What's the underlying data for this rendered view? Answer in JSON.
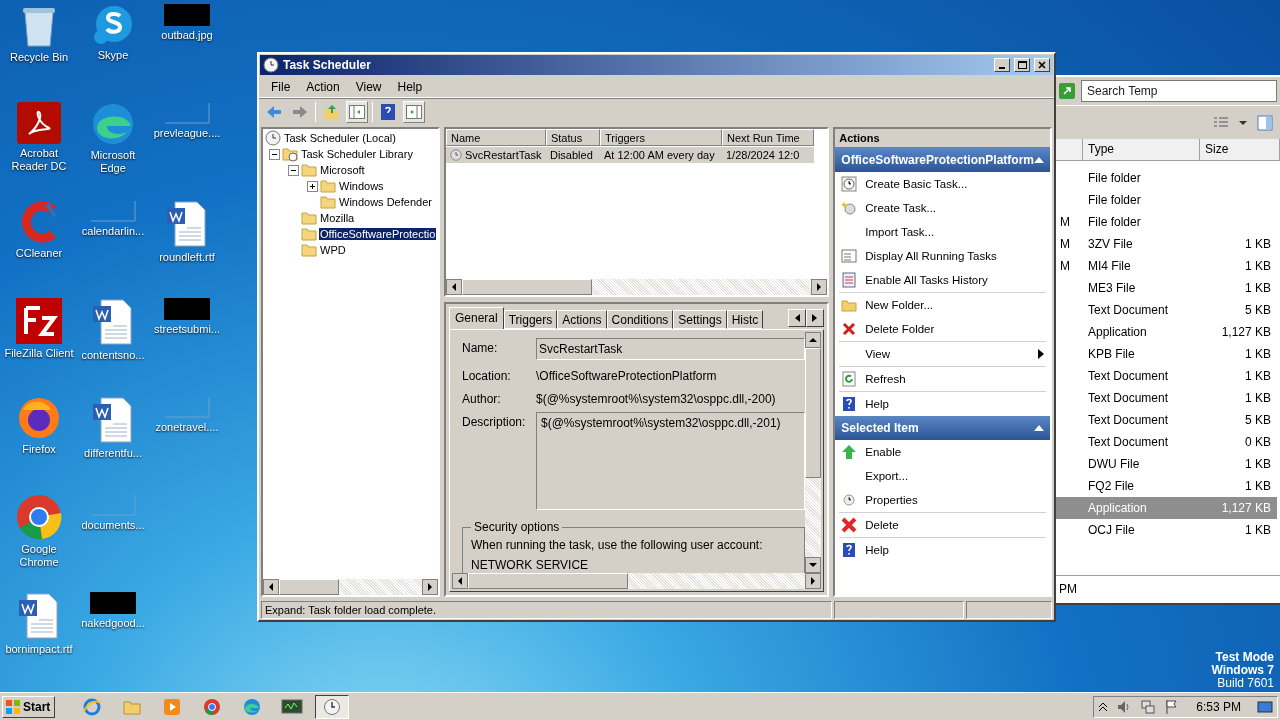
{
  "desktop_icons": [
    {
      "label": "Recycle Bin",
      "kind": "recycle"
    },
    {
      "label": "Acrobat Reader DC",
      "kind": "acrobat"
    },
    {
      "label": "CCleaner",
      "kind": "ccleaner"
    },
    {
      "label": "FileZilla Client",
      "kind": "filezilla"
    },
    {
      "label": "Firefox",
      "kind": "firefox"
    },
    {
      "label": "Google Chrome",
      "kind": "chrome"
    },
    {
      "label": "bornimpact.rtf",
      "kind": "word"
    },
    {
      "label": "Skype",
      "kind": "skype"
    },
    {
      "label": "Microsoft Edge",
      "kind": "edge"
    },
    {
      "label": "calendarlin...",
      "kind": "blank"
    },
    {
      "label": "contentsno...",
      "kind": "word"
    },
    {
      "label": "differentfu...",
      "kind": "word"
    },
    {
      "label": "documents...",
      "kind": "blank"
    },
    {
      "label": "nakedgood...",
      "kind": "redacted"
    },
    {
      "label": "outbad.jpg",
      "kind": "redacted"
    },
    {
      "label": "prevleague....",
      "kind": "blank"
    },
    {
      "label": "roundleft.rtf",
      "kind": "word"
    },
    {
      "label": "streetsubmi...",
      "kind": "redacted"
    },
    {
      "label": "zonetravel....",
      "kind": "blank"
    }
  ],
  "explorer": {
    "search": {
      "placeholder": "Search Temp"
    },
    "columns": [
      "Type",
      "Size"
    ],
    "rows": [
      {
        "column_1": "",
        "type": "File folder",
        "size": "",
        "selected": false
      },
      {
        "column_1": "",
        "type": "File folder",
        "size": "",
        "selected": false
      },
      {
        "column_1": "M",
        "type": "File folder",
        "size": "",
        "selected": false
      },
      {
        "column_1": "M",
        "type": "3ZV File",
        "size": "1 KB",
        "selected": false
      },
      {
        "column_1": "M",
        "type": "MI4 File",
        "size": "1 KB",
        "selected": false
      },
      {
        "column_1": "",
        "type": "ME3 File",
        "size": "1 KB",
        "selected": false
      },
      {
        "column_1": "",
        "type": "Text Document",
        "size": "5 KB",
        "selected": false
      },
      {
        "column_1": "",
        "type": "Application",
        "size": "1,127 KB",
        "selected": false
      },
      {
        "column_1": "",
        "type": "KPB File",
        "size": "1 KB",
        "selected": false
      },
      {
        "column_1": "",
        "type": "Text Document",
        "size": "1 KB",
        "selected": false
      },
      {
        "column_1": "",
        "type": "Text Document",
        "size": "1 KB",
        "selected": false
      },
      {
        "column_1": "",
        "type": "Text Document",
        "size": "5 KB",
        "selected": false
      },
      {
        "column_1": "",
        "type": "Text Document",
        "size": "0 KB",
        "selected": false
      },
      {
        "column_1": "",
        "type": "DWU File",
        "size": "1 KB",
        "selected": false
      },
      {
        "column_1": "",
        "type": "FQ2 File",
        "size": "1 KB",
        "selected": false
      },
      {
        "column_1": "",
        "type": "Application",
        "size": "1,127 KB",
        "selected": true
      },
      {
        "column_1": "",
        "type": "OCJ File",
        "size": "1 KB",
        "selected": false
      }
    ],
    "footer": "PM"
  },
  "task_scheduler": {
    "title": "Task Scheduler",
    "menu": [
      "File",
      "Action",
      "View",
      "Help"
    ],
    "tree": [
      {
        "label": "Task Scheduler (Local)",
        "kind": "root",
        "selected": false,
        "children": [
          {
            "label": "Task Scheduler Library",
            "kind": "library",
            "selected": false,
            "expanded": true,
            "children": [
              {
                "label": "Microsoft",
                "kind": "folder",
                "selected": false,
                "expanded": true,
                "children": [
                  {
                    "label": "Windows",
                    "kind": "folder",
                    "selected": false,
                    "expanded": false
                  },
                  {
                    "label": "Windows Defender",
                    "kind": "folder",
                    "selected": false
                  }
                ]
              },
              {
                "label": "Mozilla",
                "kind": "folder",
                "selected": false
              },
              {
                "label": "OfficeSoftwareProtectio",
                "kind": "folder",
                "selected": true
              },
              {
                "label": "WPD",
                "kind": "folder",
                "selected": false
              }
            ]
          }
        ]
      }
    ],
    "task_table": {
      "columns": [
        "Name",
        "Status",
        "Triggers",
        "Next Run Time"
      ],
      "rows": [
        {
          "cells": [
            "SvcRestartTask",
            "Disabled",
            "At 12:00 AM every day",
            "1/28/2024 12:0"
          ],
          "selected": true
        }
      ]
    },
    "detail_tabs": [
      {
        "label": "General",
        "selected": true
      },
      {
        "label": "Triggers",
        "selected": false
      },
      {
        "label": "Actions",
        "selected": false
      },
      {
        "label": "Conditions",
        "selected": false
      },
      {
        "label": "Settings",
        "selected": false
      },
      {
        "label": "Histc",
        "selected": false
      }
    ],
    "general": {
      "name_label": "Name:",
      "name": "SvcRestartTask",
      "location_label": "Location:",
      "location": "\\OfficeSoftwareProtectionPlatform",
      "author_label": "Author:",
      "author": "$(@%systemroot%\\system32\\osppc.dll,-200)",
      "description_label": "Description:",
      "description": "$(@%systemroot%\\system32\\osppc.dll,-201)",
      "security_title": "Security options",
      "security_text": "When running the task, use the following user account:",
      "account": "NETWORK SERVICE"
    },
    "status_bar": "Expand:  Task folder load complete.",
    "actions_pane": {
      "title": "Actions",
      "sections": [
        {
          "title": "OfficeSoftwareProtectionPlatform",
          "expanded": true,
          "groups": [
            [
              {
                "label": "Create Basic Task...",
                "kind": "basic-task"
              },
              {
                "label": "Create Task...",
                "kind": "new-task"
              },
              {
                "label": "Import Task...",
                "kind": "plain"
              },
              {
                "label": "Display All Running Tasks",
                "kind": "running"
              },
              {
                "label": "Enable All Tasks History",
                "kind": "history"
              }
            ],
            [
              {
                "label": "New Folder...",
                "kind": "new-folder"
              },
              {
                "label": "Delete Folder",
                "kind": "delete-small"
              }
            ],
            [
              {
                "label": "View",
                "kind": "submenu"
              }
            ],
            [
              {
                "label": "Refresh",
                "kind": "refresh"
              }
            ],
            [
              {
                "label": "Help",
                "kind": "help"
              }
            ]
          ]
        },
        {
          "title": "Selected Item",
          "expanded": true,
          "groups": [
            [
              {
                "label": "Enable",
                "kind": "enable"
              },
              {
                "label": "Export...",
                "kind": "plain"
              },
              {
                "label": "Properties",
                "kind": "properties"
              }
            ],
            [
              {
                "label": "Delete",
                "kind": "delete"
              }
            ],
            [
              {
                "label": "Help",
                "kind": "help"
              }
            ]
          ]
        }
      ]
    }
  },
  "os_notice": [
    "Test Mode",
    "Windows 7",
    "Build 7601"
  ],
  "taskbar": {
    "start": "Start",
    "apps": [
      {
        "kind": "ie",
        "active": false
      },
      {
        "kind": "explorer",
        "active": false
      },
      {
        "kind": "media",
        "active": false
      },
      {
        "kind": "chrome",
        "active": false
      },
      {
        "kind": "edge",
        "active": false
      },
      {
        "kind": "monitor",
        "active": false
      },
      {
        "kind": "scheduler",
        "active": true
      }
    ],
    "clock": "6:53 PM"
  }
}
